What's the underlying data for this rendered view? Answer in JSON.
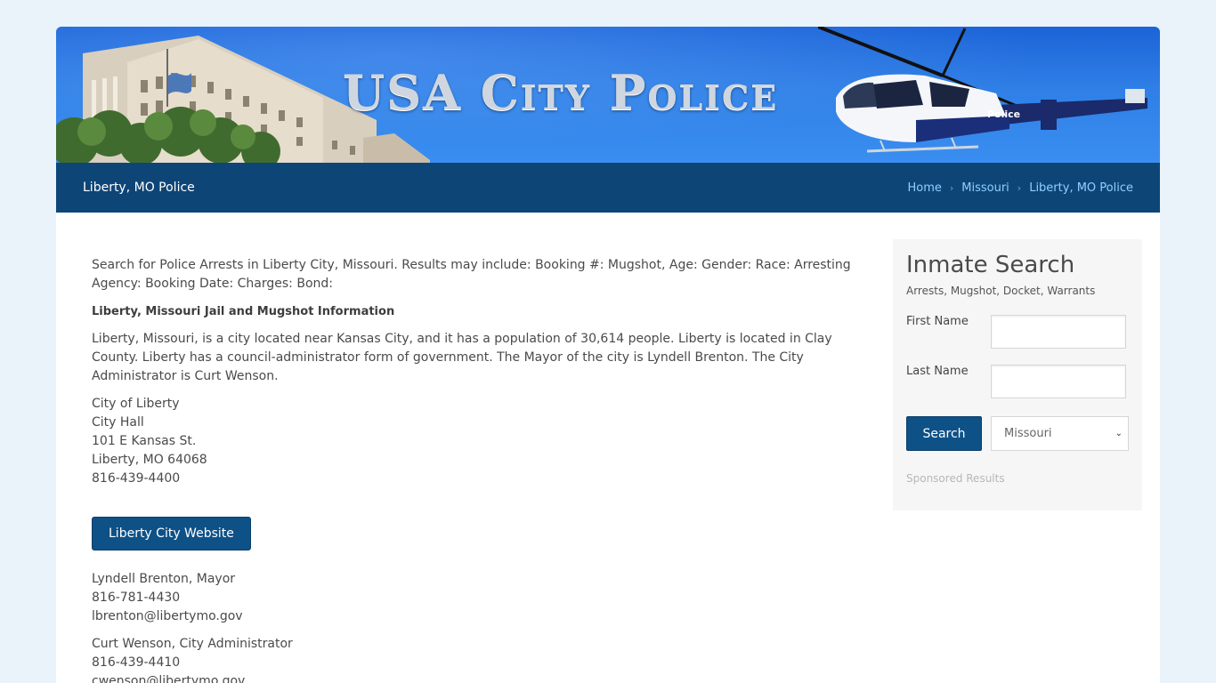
{
  "banner": {
    "title": "USA City Police",
    "heli_text": "Police"
  },
  "nav": {
    "title": "Liberty, MO Police",
    "breadcrumbs": [
      "Home",
      "Missouri",
      "Liberty, MO Police"
    ]
  },
  "main": {
    "intro": "Search for Police Arrests in Liberty City, Missouri. Results may include: Booking #: Mugshot, Age: Gender: Race: Arresting Agency: Booking Date: Charges: Bond:",
    "heading": "Liberty, Missouri Jail and Mugshot Information",
    "description": "Liberty, Missouri, is a city located near Kansas City, and it has a population of 30,614 people. Liberty is located in Clay County. Liberty has a council-administrator form of government. The Mayor of the city is Lyndell Brenton. The City Administrator is Curt Wenson.",
    "address": [
      "City of Liberty",
      "City Hall",
      "101 E Kansas St.",
      "Liberty, MO 64068",
      "816-439-4400"
    ],
    "website_button": "Liberty City Website",
    "contacts": [
      [
        "Lyndell Brenton, Mayor",
        "816-781-4430",
        "lbrenton@libertymo.gov"
      ],
      [
        "Curt Wenson, City Administrator",
        "816-439-4410",
        "cwenson@libertymo.gov"
      ]
    ]
  },
  "sidebar": {
    "title": "Inmate Search",
    "subtitle": "Arrests, Mugshot, Docket, Warrants",
    "first_name_label": "First Name",
    "last_name_label": "Last Name",
    "search_button": "Search",
    "state_selected": "Missouri",
    "sponsored": "Sponsored Results"
  },
  "colors": {
    "page_bg": "#e9f3f9",
    "nav_bg": "#0e4577",
    "breadcrumb_link": "#8fd0ff",
    "button_bg": "#0e5187",
    "sky": "#2f7fe6"
  }
}
